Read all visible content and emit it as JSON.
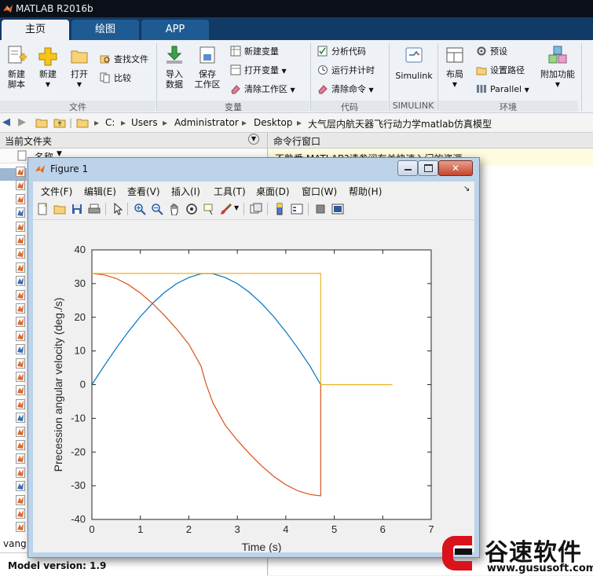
{
  "app": {
    "title": "MATLAB R2016b"
  },
  "tabs": [
    {
      "label": "主页",
      "active": true
    },
    {
      "label": "绘图",
      "active": false
    },
    {
      "label": "APP",
      "active": false
    }
  ],
  "ribbon": {
    "file": {
      "new_script": "新建\n脚本",
      "new_script_l1": "新建",
      "new_script_l2": "脚本",
      "new": "新建",
      "open": "打开",
      "find_files": "查找文件",
      "compare": "比较",
      "section": "文件"
    },
    "variable": {
      "import_l1": "导入",
      "import_l2": "数据",
      "save_l1": "保存",
      "save_l2": "工作区",
      "new_var": "新建变量",
      "open_var": "打开变量",
      "clear_ws": "清除工作区",
      "section": "变量"
    },
    "code": {
      "analyze": "分析代码",
      "run_time": "运行并计时",
      "clear_cmd": "清除命令",
      "section": "代码"
    },
    "simulink": {
      "label": "Simulink",
      "section": "SIMULINK"
    },
    "env": {
      "layout": "布局",
      "prefs": "预设",
      "set_path": "设置路径",
      "parallel": "Parallel",
      "addons": "附加功能",
      "section": "环境"
    }
  },
  "address": {
    "parts": [
      "C:",
      "Users",
      "Administrator",
      "Desktop",
      "大气层内航天器飞行动力学matlab仿真模型"
    ]
  },
  "left_panel": {
    "title": "当前文件夹",
    "col_name": "名称",
    "bottom_item": "vang",
    "model_version": "Model version: 1.9"
  },
  "command_window": {
    "title": "命令行窗口",
    "banner": "不熟悉 MATLAB?请参阅有关快速入门的资源。"
  },
  "figure": {
    "title": "Figure 1",
    "menu": [
      "文件(F)",
      "编辑(E)",
      "查看(V)",
      "插入(I)",
      "工具(T)",
      "桌面(D)",
      "窗口(W)",
      "帮助(H)"
    ]
  },
  "chart_data": {
    "type": "line",
    "title": "",
    "xlabel": "Time (s)",
    "ylabel": "Precession angular velocity (deg./s)",
    "xlim": [
      0,
      7
    ],
    "ylim": [
      -40,
      40
    ],
    "xticks": [
      0,
      1,
      2,
      3,
      4,
      5,
      6,
      7
    ],
    "yticks": [
      -40,
      -30,
      -20,
      -10,
      0,
      10,
      20,
      30,
      40
    ],
    "grid": false,
    "series": [
      {
        "color": "#0072BD",
        "x": [
          0,
          0.25,
          0.5,
          0.75,
          1.0,
          1.25,
          1.5,
          1.75,
          2.0,
          2.25,
          2.36,
          2.5,
          2.75,
          3.0,
          3.25,
          3.5,
          3.75,
          4.0,
          4.25,
          4.5,
          4.72
        ],
        "y": [
          0,
          5.5,
          10.8,
          15.7,
          20.2,
          24.1,
          27.4,
          30.0,
          31.8,
          32.9,
          33.0,
          32.9,
          31.8,
          30.0,
          27.4,
          24.1,
          20.2,
          15.7,
          10.8,
          5.5,
          0
        ]
      },
      {
        "color": "#D95319",
        "x": [
          0,
          0.25,
          0.5,
          0.75,
          1.0,
          1.25,
          1.5,
          1.75,
          2.0,
          2.25,
          2.36,
          2.5,
          2.75,
          3.0,
          3.25,
          3.5,
          3.75,
          4.0,
          4.25,
          4.5,
          4.72,
          4.72
        ],
        "y": [
          33,
          32.6,
          31.5,
          29.7,
          27.2,
          24.1,
          20.5,
          16.5,
          12.0,
          5.5,
          0,
          -5.5,
          -12.0,
          -16.5,
          -20.5,
          -24.1,
          -27.2,
          -29.7,
          -31.5,
          -32.6,
          -33,
          0
        ]
      },
      {
        "color": "#EDB120",
        "x": [
          0,
          4.72,
          4.72,
          6.2
        ],
        "y": [
          33,
          33,
          0,
          0
        ]
      }
    ]
  },
  "watermark": {
    "name": "谷速软件",
    "url": "www.gususoft.com"
  },
  "colors": {
    "tab_bg": "#123a66",
    "ribbon_bg": "#eef1f5",
    "title_bg": "#0b0f18"
  }
}
